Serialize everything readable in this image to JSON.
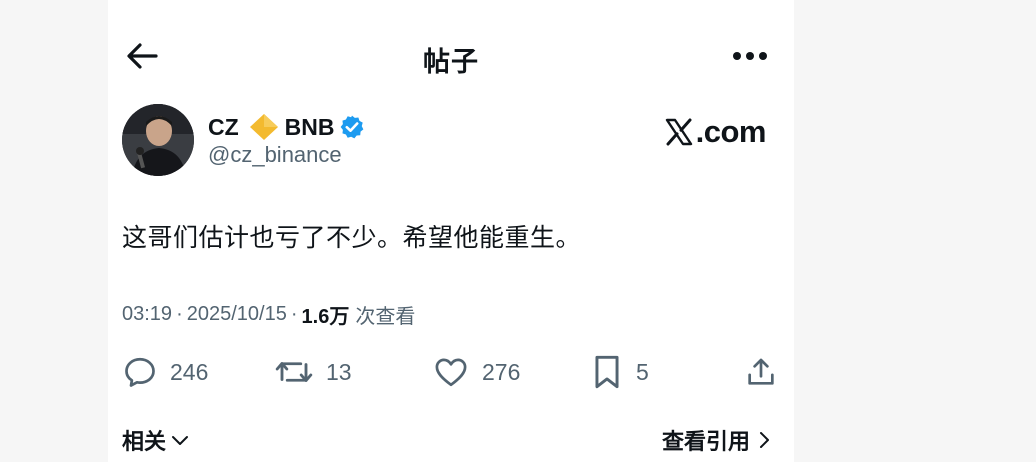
{
  "header": {
    "title": "帖子",
    "back_icon": "arrow-left-icon",
    "more_icon": "more-horizontal-icon"
  },
  "author": {
    "name": "CZ",
    "badge_text": "BNB",
    "handle": "@cz_binance",
    "verified_color": "#1d9bf0",
    "diamond_color": "#f3ba2f"
  },
  "brand": {
    "domain_text": ".com",
    "logo_icon": "x-logo-icon"
  },
  "post": {
    "text": "这哥们估计也亏了不少。希望他能重生。"
  },
  "meta": {
    "time": "03:19",
    "dot1": "·",
    "date": "2025/10/15",
    "dot2": "·",
    "views": "1.6万",
    "views_label": "次查看"
  },
  "actions": {
    "replies": "246",
    "reposts": "13",
    "likes": "276",
    "bookmarks": "5"
  },
  "footer": {
    "related": "相关",
    "view_quotes": "查看引用"
  }
}
